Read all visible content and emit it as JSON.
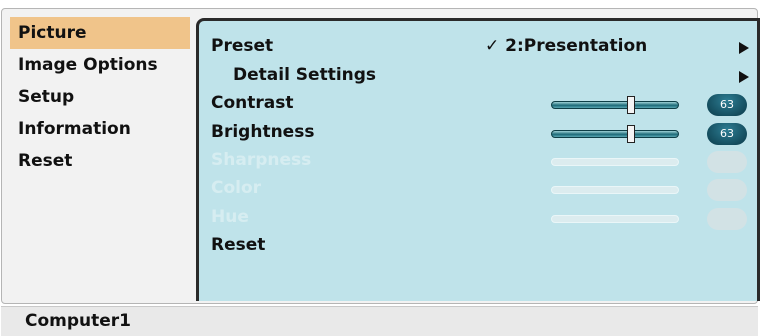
{
  "sidebar": {
    "items": [
      {
        "label": "Picture",
        "active": true
      },
      {
        "label": "Image Options"
      },
      {
        "label": "Setup"
      },
      {
        "label": "Information"
      },
      {
        "label": "Reset"
      }
    ]
  },
  "panel": {
    "preset": {
      "label": "Preset",
      "value": "✓ 2:Presentation",
      "icon": "triangle-right-icon"
    },
    "detail": {
      "label": "Detail Settings",
      "icon": "triangle-right-icon"
    },
    "contrast": {
      "label": "Contrast",
      "value": "63",
      "level": 0.63,
      "enabled": true
    },
    "brightness": {
      "label": "Brightness",
      "value": "63",
      "level": 0.63,
      "enabled": true
    },
    "sharpness": {
      "label": "Sharpness",
      "enabled": false
    },
    "color": {
      "label": "Color",
      "enabled": false
    },
    "hue": {
      "label": "Hue",
      "enabled": false
    },
    "reset": {
      "label": "Reset"
    }
  },
  "status": {
    "source": "Computer1"
  },
  "colors": {
    "panel_bg": "#bfe3ea",
    "active_tab": "#f0c48a",
    "badge": "#0b3b4a"
  }
}
